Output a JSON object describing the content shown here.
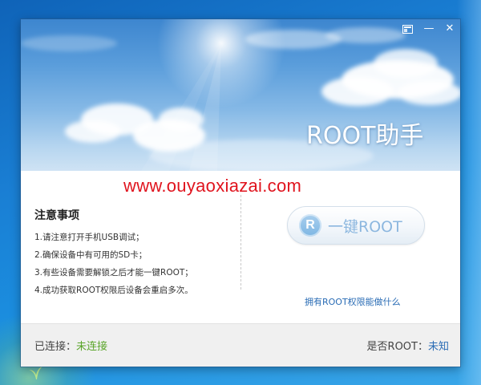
{
  "window": {
    "title": "ROOT助手",
    "titlebar": {
      "skin_icon": "skin-icon",
      "minimize_label": "—",
      "close_label": "✕"
    }
  },
  "watermark": "www.ouyaoxiazai.com",
  "notes": {
    "title": "注意事项",
    "items": [
      "1.请注意打开手机USB调试；",
      "2.确保设备中有可用的SD卡；",
      "3.有些设备需要解锁之后才能一键ROOT；",
      "4.成功获取ROOT权限后设备会重启多次。"
    ]
  },
  "root_button": {
    "logo_letter": "R",
    "label": "一键ROOT"
  },
  "root_link": "拥有ROOT权限能做什么",
  "status": {
    "connected_label": "已连接：",
    "connected_value": "未连接",
    "root_label": "是否ROOT：",
    "root_value": "未知"
  },
  "colors": {
    "watermark": "#e0141e",
    "link": "#2a6cb5",
    "connected_value": "#5aa52a"
  }
}
